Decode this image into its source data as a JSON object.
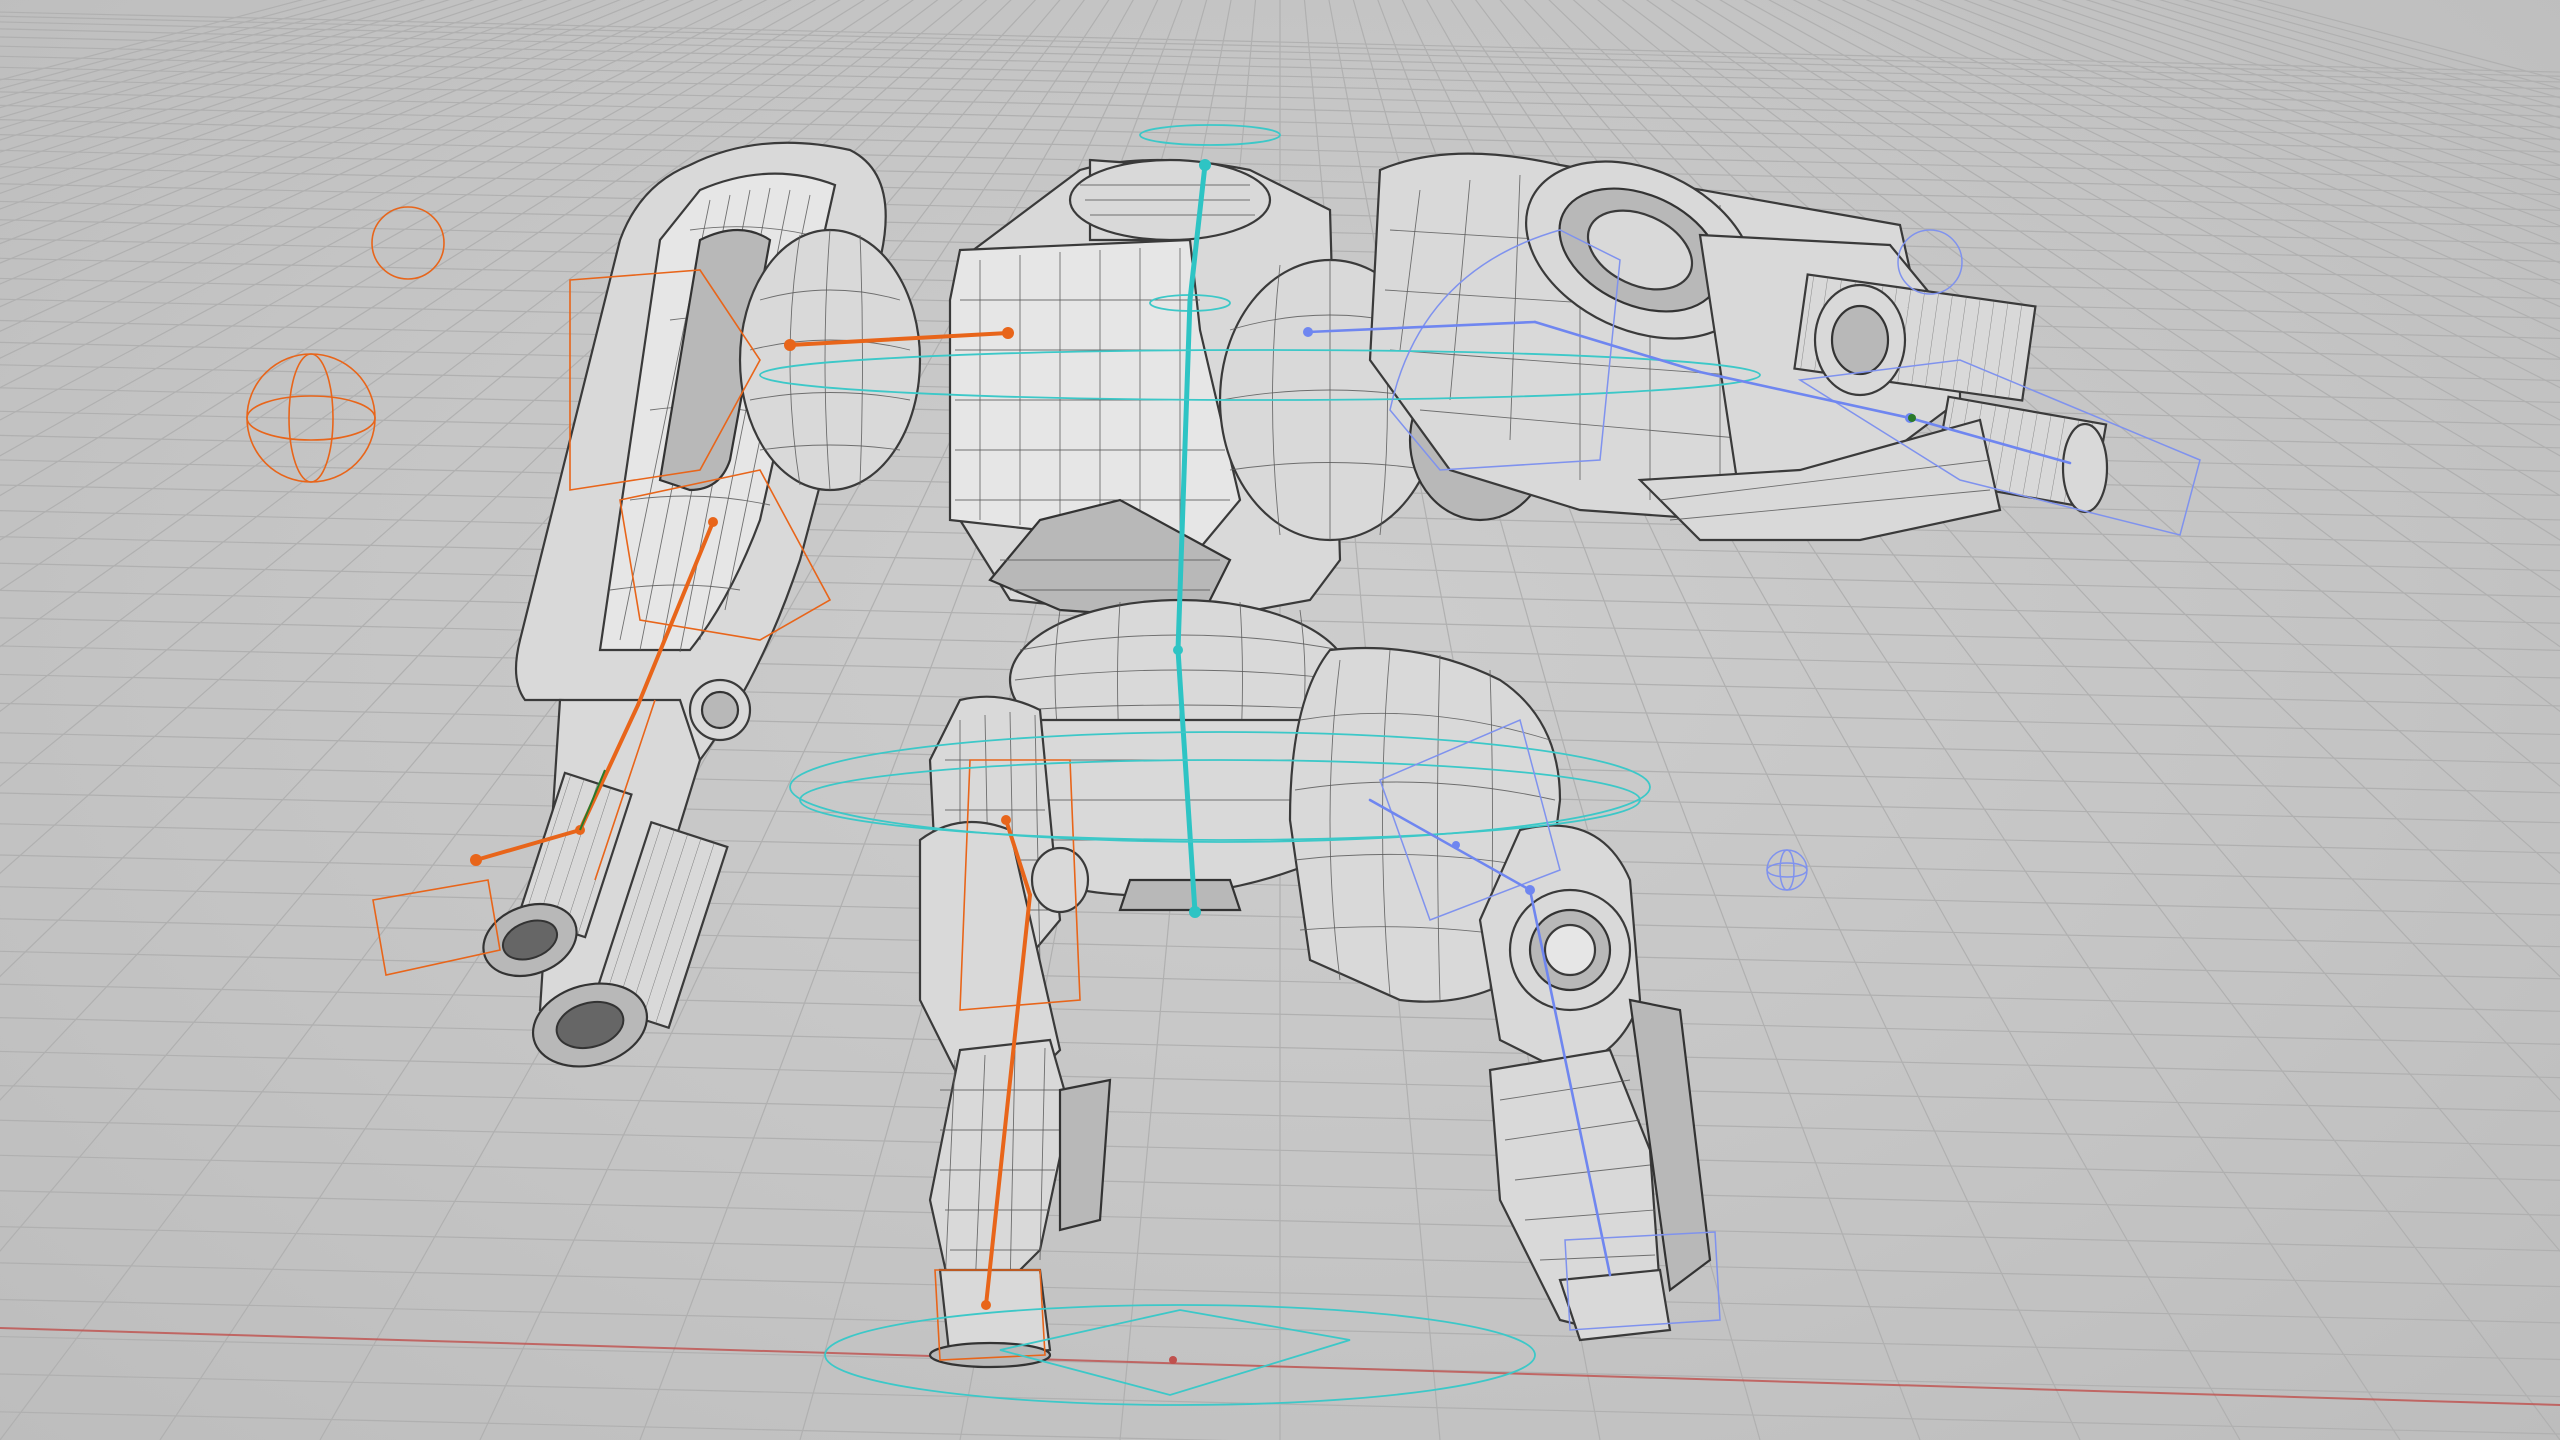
{
  "viewport": {
    "mode": "wireframe-on-shaded",
    "background": "#c6c6c6",
    "grid_color": "#b3b3b3",
    "ground_axis_color": "#c0504d"
  },
  "model": {
    "mesh_color": "#d9d9d9",
    "wire_color": "#3a3a3a"
  },
  "rig": {
    "left_arm_color": "#e8651a",
    "spine_color": "#2ec4c4",
    "right_side_color": "#6f86f0"
  }
}
